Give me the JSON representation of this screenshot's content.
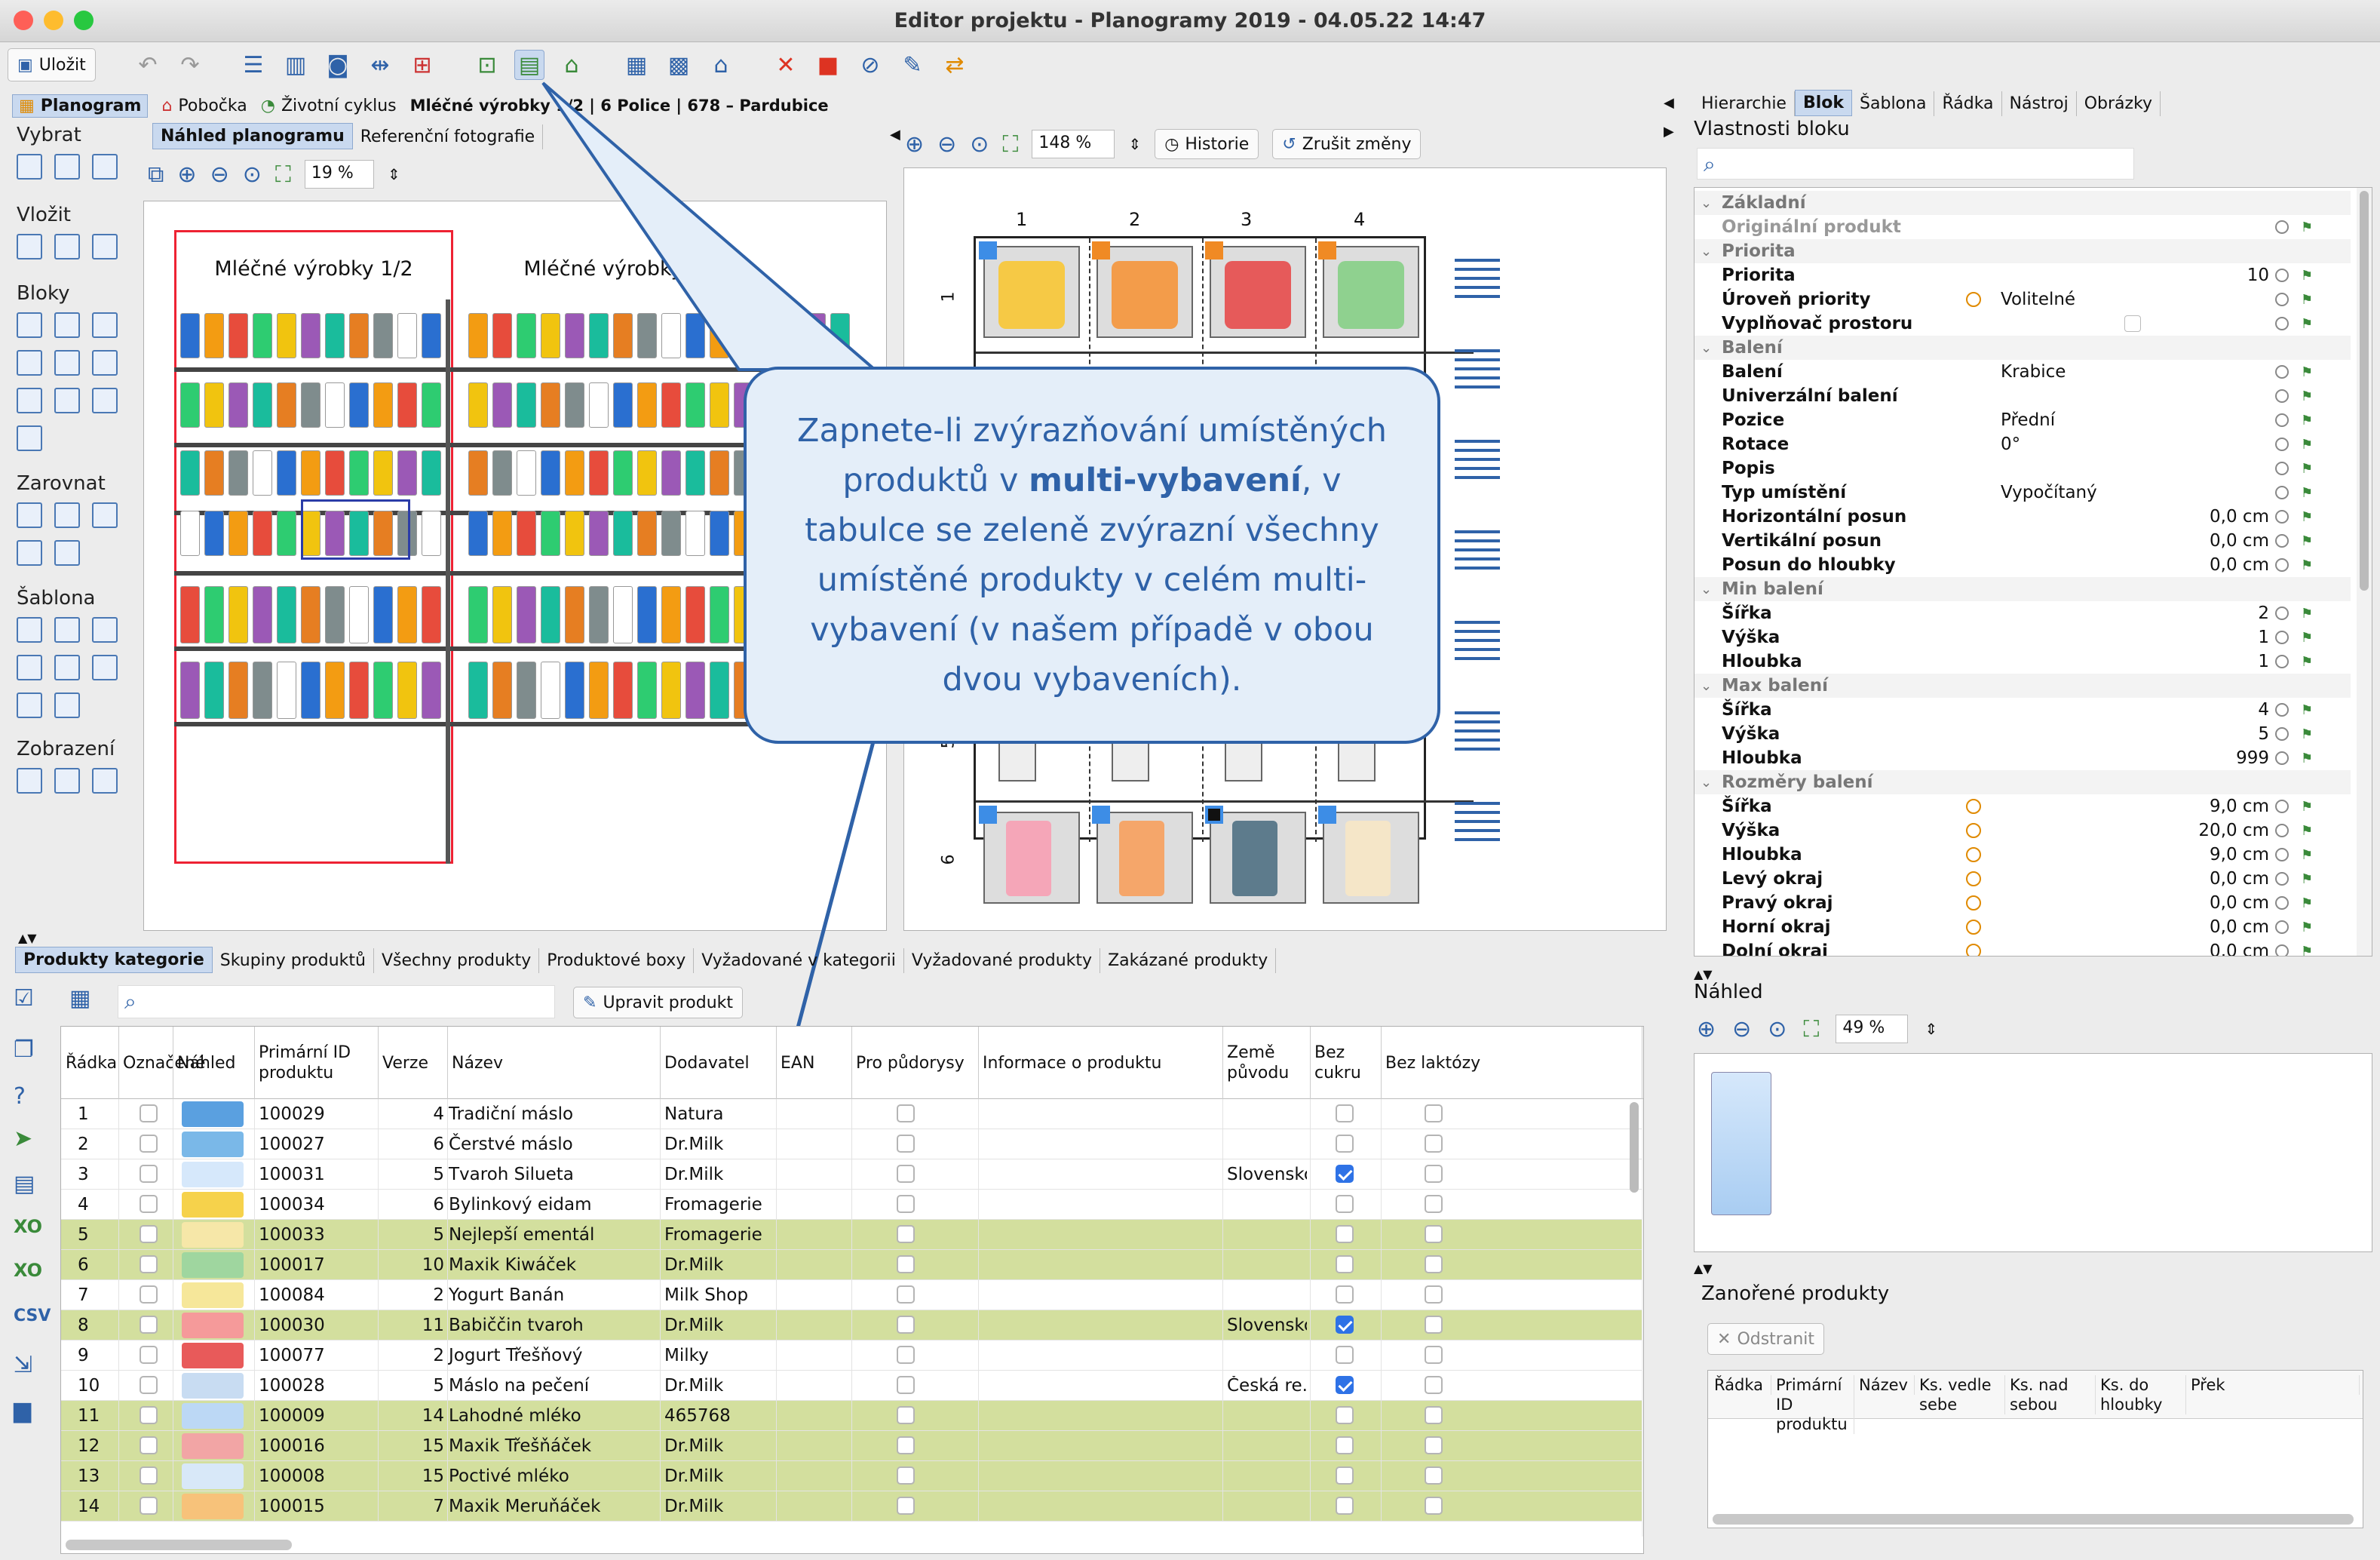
{
  "window": {
    "title": "Editor projektu - Planogramy 2019 - 04.05.22 14:47"
  },
  "toolbar": {
    "save_label": "Uložit"
  },
  "breadcrumb": {
    "planogram": "Planogram",
    "branch": "Pobočka",
    "lifecycle": "Životní cyklus",
    "path": "Mléčné výrobky 1/2 | 6 Police | 678 – Pardubice"
  },
  "left_tools": {
    "select": "Vybrat",
    "insert": "Vložit",
    "blocks": "Bloky",
    "align": "Zarovnat",
    "template": "Šablona",
    "display": "Zobrazení"
  },
  "preview_tabs": [
    "Náhled planogramu",
    "Referenční fotografie"
  ],
  "preview": {
    "zoom": "19 %",
    "section1": "Mléčné výrobky 1/2",
    "section2": "Mléčné výrobky 2/2"
  },
  "block_view": {
    "zoom": "148 %",
    "history": "Historie",
    "cancel": "Zrušit změny",
    "columns": [
      "1",
      "2",
      "3",
      "4"
    ],
    "rows": [
      "1",
      "5",
      "6"
    ]
  },
  "callout": {
    "text_before": "Zapnete-li zvýrazňování umístěných produktů v ",
    "text_bold": "multi-vybavení",
    "text_after": ", v tabulce se zeleně zvýrazní všechny umístěné produkty v celém multi-vybavení (v našem případě v obou dvou vybaveních)."
  },
  "right_tabs": [
    "Hierarchie",
    "Blok",
    "Šablona",
    "Řádka",
    "Nástroj",
    "Obrázky"
  ],
  "block_props": {
    "title": "Vlastnosti bloku",
    "rows": [
      {
        "k": "Základní",
        "grp": true
      },
      {
        "k": "Originální produkt",
        "dim": true
      },
      {
        "k": "Priorita",
        "grp": true
      },
      {
        "k": "Priorita",
        "vr": "10"
      },
      {
        "k": "Úroveň priority",
        "v": "Volitelné",
        "warn": true
      },
      {
        "k": "Vyplňovač prostoru",
        "box": true
      },
      {
        "k": "Balení",
        "grp": true
      },
      {
        "k": "Balení",
        "v": "Krabice"
      },
      {
        "k": "Univerzální balení"
      },
      {
        "k": "Pozice",
        "v": "Přední"
      },
      {
        "k": "Rotace",
        "v": "0°"
      },
      {
        "k": "Popis"
      },
      {
        "k": "Typ umístění",
        "v": "Vypočítaný"
      },
      {
        "k": "Horizontální posun",
        "vr": "0,0 cm"
      },
      {
        "k": "Vertikální posun",
        "vr": "0,0 cm"
      },
      {
        "k": "Posun do hloubky",
        "vr": "0,0 cm"
      },
      {
        "k": "Min balení",
        "grp": true
      },
      {
        "k": "Šířka",
        "vr": "2"
      },
      {
        "k": "Výška",
        "vr": "1"
      },
      {
        "k": "Hloubka",
        "vr": "1"
      },
      {
        "k": "Max balení",
        "grp": true
      },
      {
        "k": "Šířka",
        "vr": "4"
      },
      {
        "k": "Výška",
        "vr": "5"
      },
      {
        "k": "Hloubka",
        "vr": "999"
      },
      {
        "k": "Rozměry balení",
        "grp": true
      },
      {
        "k": "Šířka",
        "vr": "9,0 cm",
        "warn": true
      },
      {
        "k": "Výška",
        "vr": "20,0 cm",
        "warn": true
      },
      {
        "k": "Hloubka",
        "vr": "9,0 cm",
        "warn": true
      },
      {
        "k": "Levý okraj",
        "vr": "0,0 cm",
        "warn": true
      },
      {
        "k": "Pravý okraj",
        "vr": "0,0 cm",
        "warn": true
      },
      {
        "k": "Horní okraj",
        "vr": "0,0 cm",
        "warn": true
      },
      {
        "k": "Dolní okraj",
        "vr": "0,0 cm",
        "warn": true
      }
    ]
  },
  "preview_panel": {
    "title": "Náhled",
    "zoom": "49 %"
  },
  "nested": {
    "title": "Zanořené produkty",
    "remove": "Odstranit",
    "columns": [
      "Řádka",
      "Primární ID produktu",
      "Název",
      "Ks. vedle sebe",
      "Ks. nad sebou",
      "Ks. do hloubky",
      "Přek"
    ]
  },
  "bottom_tabs": [
    "Produkty kategorie",
    "Skupiny produktů",
    "Všechny produkty",
    "Produktové boxy",
    "Vyžadované v kategorii",
    "Vyžadované produkty",
    "Zakázané produkty"
  ],
  "edit_product": "Upravit produkt",
  "table": {
    "headers": [
      "Řádka",
      "Označené",
      "Náhled",
      "Primární ID produktu",
      "Verze",
      "Název",
      "Dodavatel",
      "EAN",
      "Pro půdorysy",
      "Informace o produktu",
      "Země původu",
      "Bez cukru",
      "Bez laktózy"
    ],
    "rows": [
      {
        "n": "1",
        "id": "100029",
        "ver": "4",
        "name": "Tradiční máslo",
        "sup": "Natura",
        "country": "",
        "sugar": false,
        "hl": false
      },
      {
        "n": "2",
        "id": "100027",
        "ver": "6",
        "name": "Čerstvé máslo",
        "sup": "Dr.Milk",
        "country": "",
        "sugar": false,
        "hl": false
      },
      {
        "n": "3",
        "id": "100031",
        "ver": "5",
        "name": "Tvaroh Silueta",
        "sup": "Dr.Milk",
        "country": "Slovensko",
        "sugar": true,
        "hl": false
      },
      {
        "n": "4",
        "id": "100034",
        "ver": "6",
        "name": "Bylinkový eidam",
        "sup": "Fromagerie",
        "country": "",
        "sugar": false,
        "hl": false
      },
      {
        "n": "5",
        "id": "100033",
        "ver": "5",
        "name": "Nejlepší ementál",
        "sup": "Fromagerie",
        "country": "",
        "sugar": false,
        "hl": true
      },
      {
        "n": "6",
        "id": "100017",
        "ver": "10",
        "name": "Maxik Kiwáček",
        "sup": "Dr.Milk",
        "country": "",
        "sugar": false,
        "hl": true
      },
      {
        "n": "7",
        "id": "100084",
        "ver": "2",
        "name": "Yogurt Banán",
        "sup": "Milk Shop",
        "country": "",
        "sugar": false,
        "hl": false
      },
      {
        "n": "8",
        "id": "100030",
        "ver": "11",
        "name": "Babiččin tvaroh",
        "sup": "Dr.Milk",
        "country": "Slovensko",
        "sugar": true,
        "hl": true
      },
      {
        "n": "9",
        "id": "100077",
        "ver": "2",
        "name": "Jogurt Třešňový",
        "sup": "Milky",
        "country": "",
        "sugar": false,
        "hl": false
      },
      {
        "n": "10",
        "id": "100028",
        "ver": "5",
        "name": "Máslo na pečení",
        "sup": "Dr.Milk",
        "country": "Česká re...",
        "sugar": true,
        "hl": false
      },
      {
        "n": "11",
        "id": "100009",
        "ver": "14",
        "name": "Lahodné mléko",
        "sup": "465768",
        "country": "",
        "sugar": false,
        "hl": true
      },
      {
        "n": "12",
        "id": "100016",
        "ver": "15",
        "name": "Maxik Třešňáček",
        "sup": "Dr.Milk",
        "country": "",
        "sugar": false,
        "hl": true
      },
      {
        "n": "13",
        "id": "100008",
        "ver": "15",
        "name": "Poctivé mléko",
        "sup": "Dr.Milk",
        "country": "",
        "sugar": false,
        "hl": true
      },
      {
        "n": "14",
        "id": "100015",
        "ver": "7",
        "name": "Maxik Meruňáček",
        "sup": "Dr.Milk",
        "country": "",
        "sugar": false,
        "hl": true
      }
    ]
  },
  "colors": {
    "highlight": "#d3df9e",
    "accent": "#2f62a8",
    "callout": "#e4eef9"
  }
}
